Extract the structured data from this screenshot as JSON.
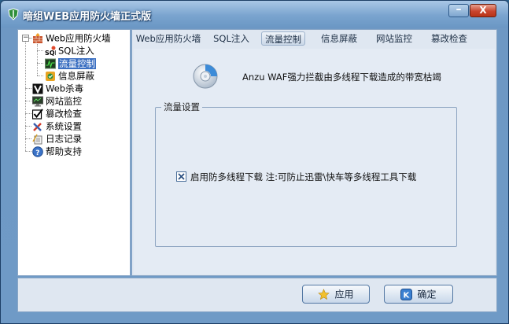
{
  "window": {
    "title": "暗组WEB应用防火墙正式版",
    "minimize_label": "–",
    "close_label": "X"
  },
  "tree": {
    "root": {
      "label": "Web应用防火墙",
      "expander": "−"
    },
    "children": [
      {
        "label": "SQL注入",
        "icon": "sql-icon"
      },
      {
        "label": "流量控制",
        "icon": "traffic-monitor-icon"
      },
      {
        "label": "信息屏蔽",
        "icon": "shield-block-icon"
      }
    ],
    "items": [
      {
        "label": "Web杀毒",
        "icon": "v-antivirus-icon"
      },
      {
        "label": "网站监控",
        "icon": "monitor-icon"
      },
      {
        "label": "篡改检查",
        "icon": "checkmark-icon"
      },
      {
        "label": "系统设置",
        "icon": "tools-icon"
      },
      {
        "label": "日志记录",
        "icon": "log-icon"
      },
      {
        "label": "帮助支持",
        "icon": "help-icon"
      }
    ],
    "selected": "流量控制"
  },
  "tabs": [
    {
      "label": "Web应用防火墙"
    },
    {
      "label": "SQL注入"
    },
    {
      "label": "流量控制"
    },
    {
      "label": "信息屏蔽"
    },
    {
      "label": "网站监控"
    },
    {
      "label": "篡改检查"
    }
  ],
  "active_tab": "流量控制",
  "panel": {
    "info_text": "Anzu WAF强力拦截由多线程下载造成的带宽枯竭",
    "group_title": "流量设置",
    "checkbox_label": "启用防多线程下载 注:可防止迅雷\\快车等多线程工具下载",
    "checkbox_checked": true
  },
  "footer": {
    "apply_label": "应用",
    "ok_label": "确定"
  },
  "colors": {
    "titlebar": "#7aa4cf",
    "selected_item": "#3b6fc1",
    "close_button": "#c8452e"
  }
}
